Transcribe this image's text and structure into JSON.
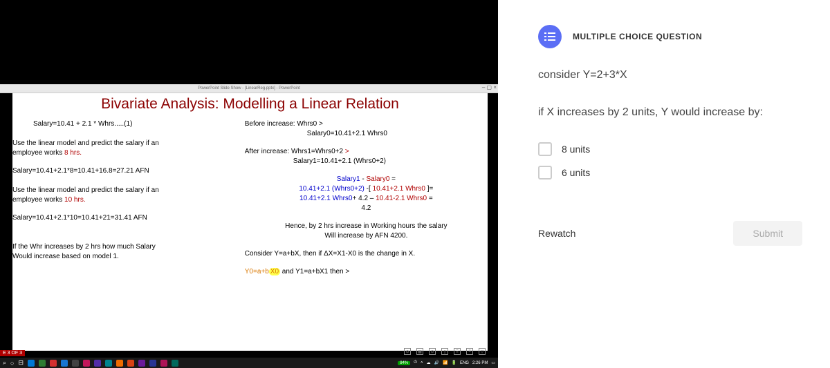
{
  "ppt": {
    "titlebar": "PowerPoint Slide Show - [LinearReg.pptx] - PowerPoint",
    "slide_title": "Bivariate Analysis: Modelling a Linear Relation",
    "left": {
      "eq1": "Salary=10.41 + 2.1 * Whrs.....(1)",
      "p1a": "Use the linear model and predict the salary if an",
      "p1b": "employee works ",
      "p1c": "8 hrs.",
      "eq2": "Salary=10.41+2.1*8=10.41+16.8=27.21 AFN",
      "p2a": "Use the linear model and predict the salary if an",
      "p2b": "employee works ",
      "p2c": "10 hrs.",
      "eq3": "Salary=10.41+2.1*10=10.41+21=31.41 AFN",
      "p3a": "If the Whr increases by 2 hrs how much Salary",
      "p3b": "Would increase based on model 1."
    },
    "right": {
      "r1": "Before increase: Whrs0 >",
      "r1b": "Salary0=10.41+2.1 Whrs0",
      "r2a": "After increase: Whrs1=Whrs0+2 ",
      "r2a2": ">",
      "r2b": "Salary1=10.41+2.1 (Whrs0+2)",
      "r3a": "Salary1",
      "r3b": " - ",
      "r3c": "Salary0",
      "r3d": " =",
      "r4a": "10.41+2.1 (Whrs0+2)",
      "r4b": " -[ ",
      "r4c": "10.41+2.1 Whrs0",
      "r4d": " ]=",
      "r5a": "10.41+2.1 Whrs0",
      "r5b": "+ 4.2 – ",
      "r5c": "10.41-2.1 Whrs0",
      "r5d": " =",
      "r6": "4.2",
      "r7a": "Hence, by 2 hrs increase in Working hours the salary",
      "r7b": "Will increase by AFN 4200.",
      "r8": "Consider Y=a+bX, then if ΔX=X1-X0 is the change in X.",
      "r9a": "Y0=a+b",
      "r9b": "X0",
      "r9c": " and ",
      "r9d": "Y1=a+bX1 then >"
    },
    "marker": "E 3 OF 3"
  },
  "taskbar": {
    "battery": "84%",
    "lang": "ENG",
    "time": "2:26 PM"
  },
  "question": {
    "type": "MULTIPLE CHOICE QUESTION",
    "stem1": "consider Y=2+3*X",
    "stem2": "if X increases by 2 units, Y would increase by:",
    "choices": [
      "8 units",
      "6 units"
    ],
    "rewatch": "Rewatch",
    "submit": "Submit"
  }
}
